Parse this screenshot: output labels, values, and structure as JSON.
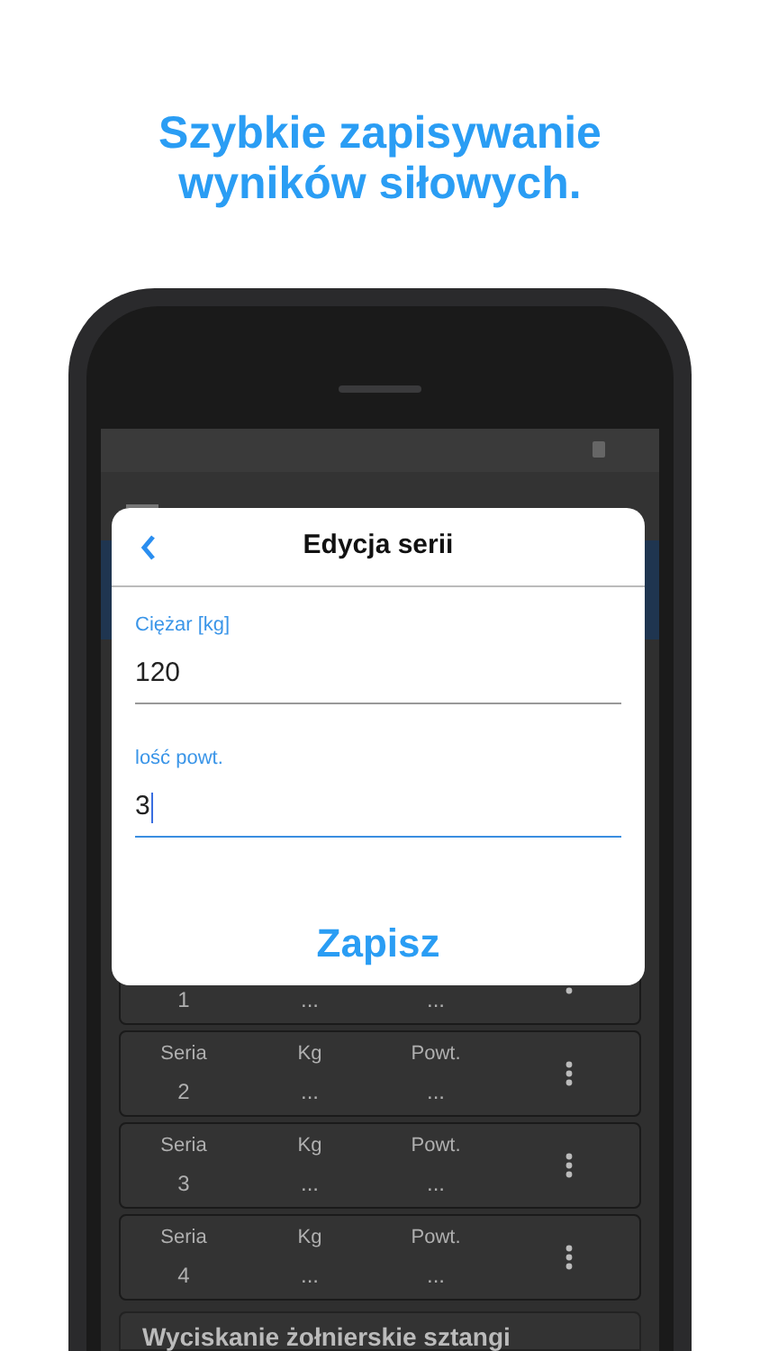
{
  "headline": [
    "Szybkie zapisywanie",
    "wyników siłowych."
  ],
  "dialog": {
    "title": "Edycja serii",
    "fields": [
      {
        "label": "Ciężar [kg]",
        "value": "120",
        "focused": false
      },
      {
        "label": "lość powt.",
        "value": "3",
        "focused": true
      }
    ],
    "save_button": "Zapisz"
  },
  "series": [
    {
      "number": "1",
      "kg": "...",
      "reps": "..."
    },
    {
      "label": "Seria",
      "number": "2",
      "kg_label": "Kg",
      "kg": "...",
      "reps_label": "Powt.",
      "reps": "..."
    },
    {
      "label": "Seria",
      "number": "3",
      "kg_label": "Kg",
      "kg": "...",
      "reps_label": "Powt.",
      "reps": "..."
    },
    {
      "label": "Seria",
      "number": "4",
      "kg_label": "Kg",
      "kg": "...",
      "reps_label": "Powt.",
      "reps": "..."
    }
  ],
  "next_exercise": "Wyciskanie żołnierskie sztangi"
}
